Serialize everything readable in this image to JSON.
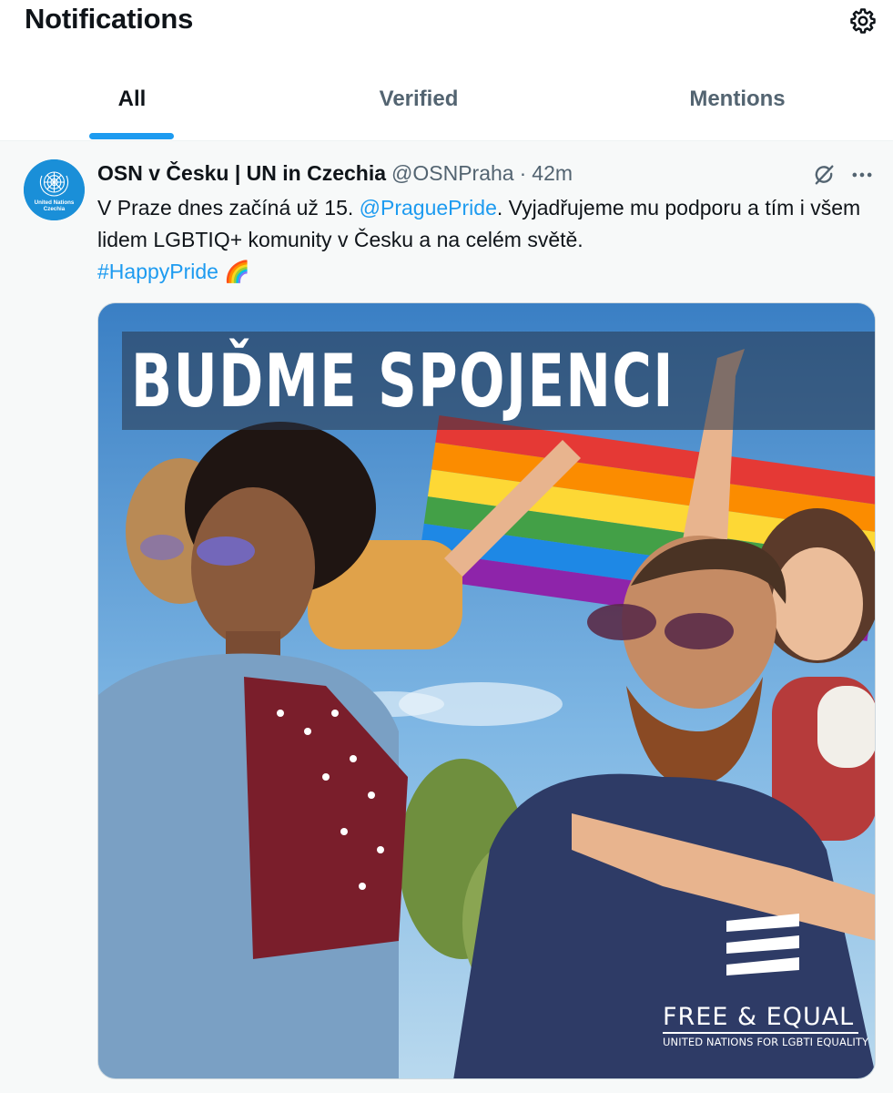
{
  "header": {
    "title": "Notifications",
    "settings_icon": "gear-icon"
  },
  "tabs": [
    {
      "label": "All",
      "active": true
    },
    {
      "label": "Verified",
      "active": false
    },
    {
      "label": "Mentions",
      "active": false
    }
  ],
  "colors": {
    "accent": "#1d9bf0",
    "text": "#0f1419",
    "secondary": "#536471",
    "row_background": "#f7f9f9"
  },
  "tweet": {
    "author": "OSN v Česku | UN in Czechia",
    "handle": "@OSNPraha",
    "separator": "·",
    "time": "42m",
    "avatar_text": {
      "line1": "United Nations",
      "line2": "Czechia"
    },
    "text_1": "V Praze dnes začíná už 15. ",
    "mention": "@PraguePride",
    "text_2": ". Vyjadřujeme mu podporu a tím i všem lidem LGBTIQ+ komunity v Česku a na celém světě.",
    "hashtag": "#HappyPride",
    "emoji": "🌈",
    "media": {
      "headline": "BUĎME SPOJENCI",
      "brand_name": "FREE & EQUAL",
      "brand_sub": "UNITED NATIONS FOR LGBTI EQUALITY"
    }
  }
}
